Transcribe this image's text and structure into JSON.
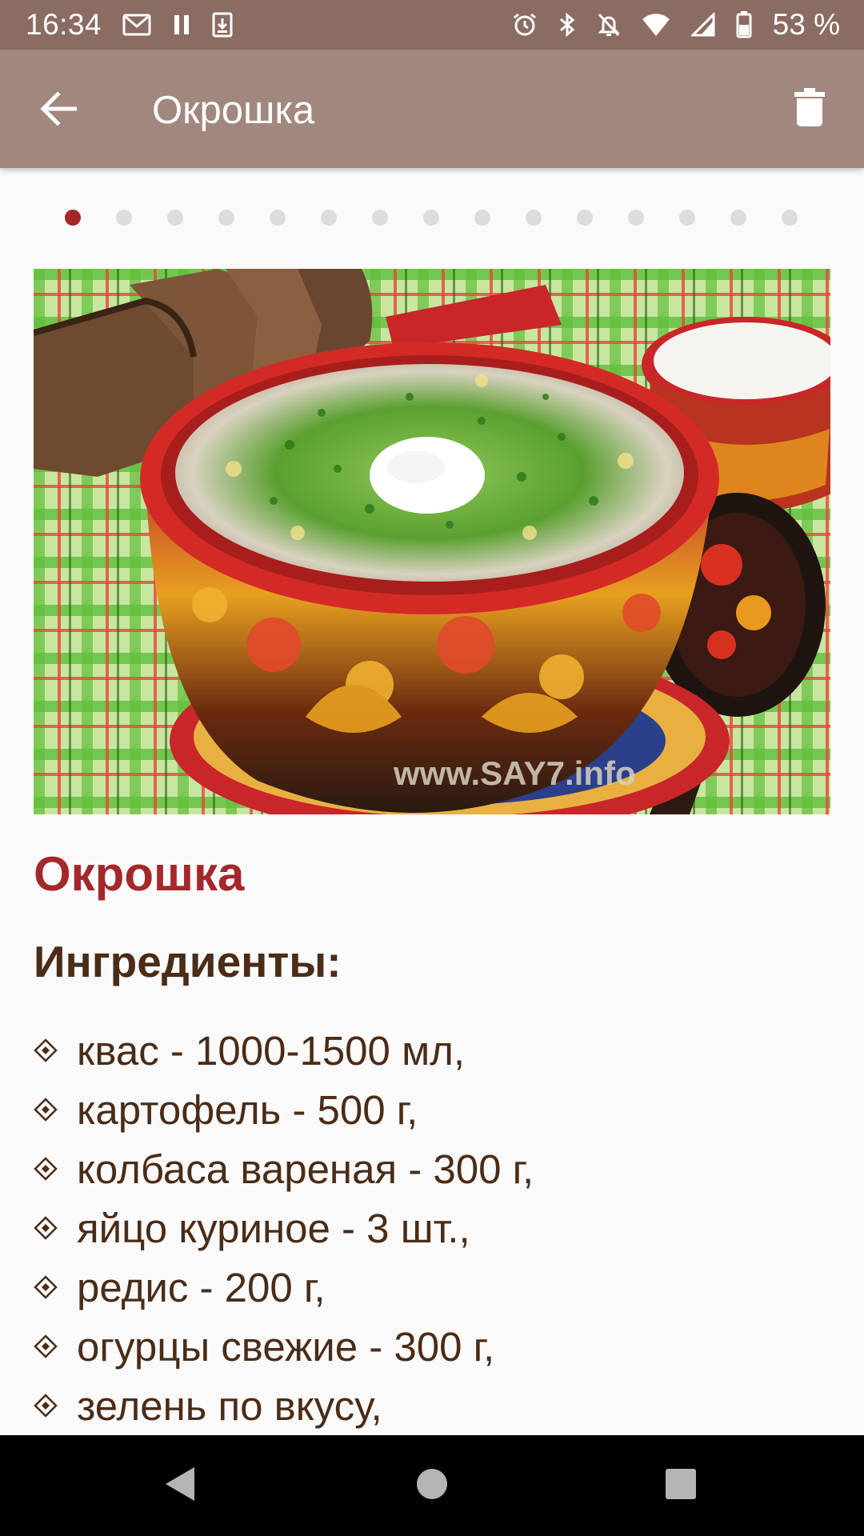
{
  "status_bar": {
    "time": "16:34",
    "battery_percent": "53 %",
    "icons": [
      "gmail-icon",
      "pause-icon",
      "download-icon",
      "alarm-icon",
      "bluetooth-icon",
      "notifications-off-icon",
      "wifi-icon",
      "signal-icon",
      "battery-icon"
    ]
  },
  "app_bar": {
    "title": "Окрошка",
    "back_icon": "arrow-back-icon",
    "delete_icon": "trash-icon"
  },
  "pager": {
    "count": 15,
    "active_index": 0
  },
  "photo": {
    "description_icon": "okroshka-photo",
    "watermark": "www.SAY7.info"
  },
  "recipe": {
    "title": "Окрошка",
    "ingredients_heading": "Ингредиенты:",
    "ingredients": [
      "квас - 1000-1500 мл,",
      "картофель - 500 г,",
      "колбаса вареная - 300 г,",
      "яйцо куриное - 3 шт.,",
      "редис - 200 г,",
      "огурцы свежие - 300 г,",
      "зелень по вкусу,"
    ]
  },
  "colors": {
    "status_bar": "#8a6c63",
    "app_bar": "#a1877e",
    "accent": "#a3282c",
    "text": "#4a2c17"
  },
  "nav_bar": {
    "icons": [
      "back-triangle-icon",
      "home-circle-icon",
      "recents-square-icon"
    ]
  }
}
